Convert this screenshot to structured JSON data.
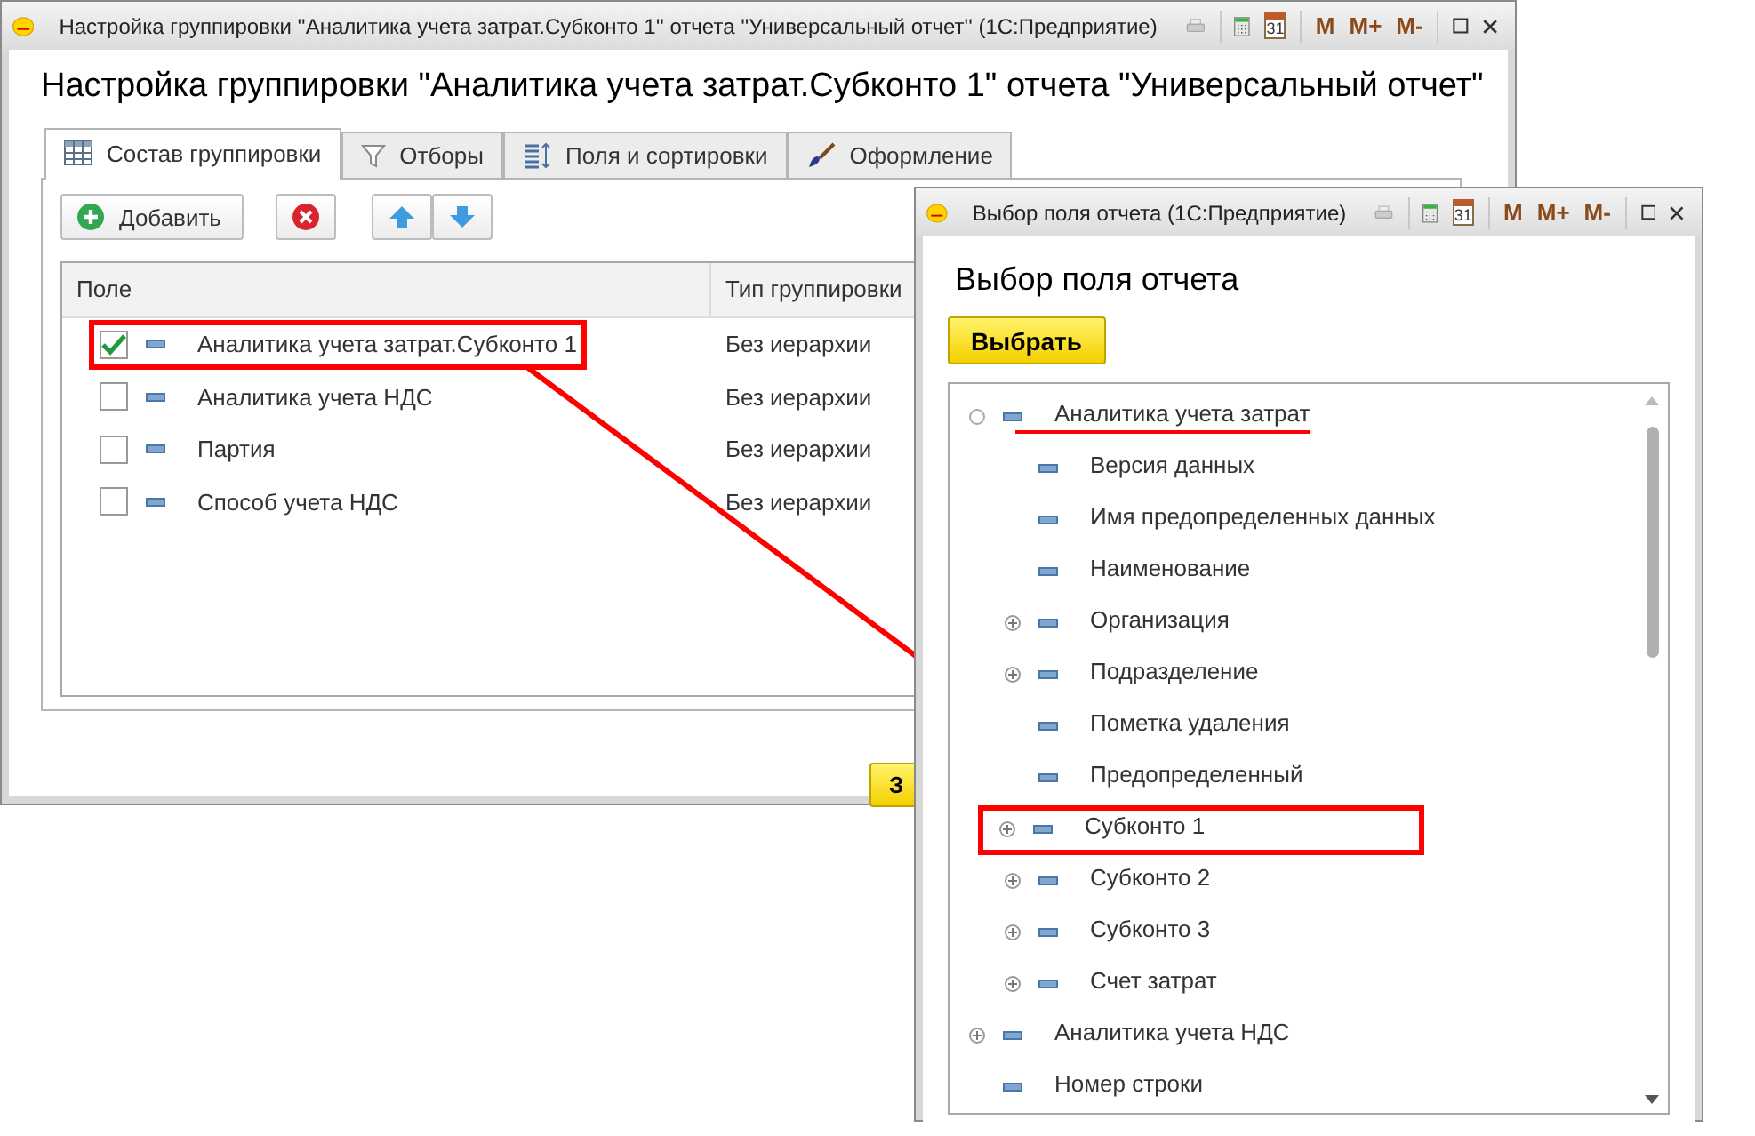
{
  "main_window": {
    "title": "Настройка группировки ''Аналитика учета затрат.Субконто 1'' отчета ''Универсальный отчет''  (1С:Предприятие)",
    "title_buttons": [
      "M",
      "M+",
      "M-"
    ],
    "calendar_day": "31",
    "heading": "Настройка группировки \"Аналитика учета затрат.Субконто 1\" отчета \"Универсальный отчет\"",
    "tabs": [
      {
        "label": "Состав группировки",
        "selected": true
      },
      {
        "label": "Отборы",
        "selected": false
      },
      {
        "label": "Поля и сортировки",
        "selected": false
      },
      {
        "label": "Оформление",
        "selected": false
      }
    ],
    "add_button": "Добавить",
    "table": {
      "columns": [
        "Поле",
        "Тип группировки"
      ],
      "rows": [
        {
          "checked": true,
          "highlighted": true,
          "field": "Аналитика учета затрат.Субконто 1",
          "type": "Без иерархии"
        },
        {
          "checked": false,
          "highlighted": false,
          "field": "Аналитика учета НДС",
          "type": "Без иерархии"
        },
        {
          "checked": false,
          "highlighted": false,
          "field": "Партия",
          "type": "Без иерархии"
        },
        {
          "checked": false,
          "highlighted": false,
          "field": "Способ учета НДС",
          "type": "Без иерархии"
        }
      ]
    },
    "footer_button": "З"
  },
  "dialog": {
    "title": "Выбор поля отчета  (1С:Предприятие)",
    "title_buttons": [
      "M",
      "M+",
      "M-"
    ],
    "calendar_day": "31",
    "heading": "Выбор поля отчета",
    "select_button": "Выбрать",
    "tree": [
      {
        "label": "Аналитика учета затрат",
        "has_children": true,
        "expanded": true,
        "underlined": true,
        "highlighted": false,
        "children": [
          {
            "label": "Версия данных",
            "has_children": false,
            "underlined": false,
            "highlighted": false
          },
          {
            "label": "Имя предопределенных данных",
            "has_children": false,
            "underlined": false,
            "highlighted": false
          },
          {
            "label": "Наименование",
            "has_children": false,
            "underlined": false,
            "highlighted": false
          },
          {
            "label": "Организация",
            "has_children": true,
            "expanded": false,
            "underlined": false,
            "highlighted": false
          },
          {
            "label": "Подразделение",
            "has_children": true,
            "expanded": false,
            "underlined": false,
            "highlighted": false
          },
          {
            "label": "Пометка удаления",
            "has_children": false,
            "underlined": false,
            "highlighted": false
          },
          {
            "label": "Предопределенный",
            "has_children": false,
            "underlined": false,
            "highlighted": false
          },
          {
            "label": "Субконто 1",
            "has_children": true,
            "expanded": false,
            "underlined": false,
            "highlighted": true
          },
          {
            "label": "Субконто 2",
            "has_children": true,
            "expanded": false,
            "underlined": false,
            "highlighted": false
          },
          {
            "label": "Субконто 3",
            "has_children": true,
            "expanded": false,
            "underlined": false,
            "highlighted": false
          },
          {
            "label": "Счет затрат",
            "has_children": true,
            "expanded": false,
            "underlined": false,
            "highlighted": false
          }
        ]
      },
      {
        "label": "Аналитика учета НДС",
        "has_children": true,
        "expanded": false,
        "underlined": false,
        "highlighted": false
      },
      {
        "label": "Номер строки",
        "has_children": false,
        "underlined": false,
        "highlighted": false
      }
    ]
  }
}
